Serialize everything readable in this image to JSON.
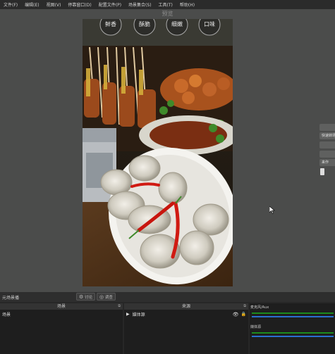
{
  "menu": [
    "文件(F)",
    "编辑(E)",
    "视图(V)",
    "停靠窗口(D)",
    "配置文件(P)",
    "场景集合(S)",
    "工具(T)",
    "帮助(H)"
  ],
  "preview": {
    "label": "预览",
    "bowl_labels": [
      "鲜香",
      "酥脆",
      "细嫩",
      "口味"
    ]
  },
  "right_panel": {
    "buttons": [
      "",
      "快速转场",
      "",
      "",
      "来作"
    ]
  },
  "mode": {
    "label": "元场景播",
    "btn1": "讨论",
    "btn2": "调查"
  },
  "docks": {
    "scenes": {
      "title": "场景",
      "items": [
        "场景"
      ]
    },
    "sources": {
      "title": "来源",
      "items": [
        {
          "name": "媒体源"
        }
      ]
    },
    "mixer": {
      "title": "混音器",
      "tracks": [
        {
          "name": "麦克风/Aux"
        },
        {
          "name": "媒体源"
        }
      ]
    }
  }
}
